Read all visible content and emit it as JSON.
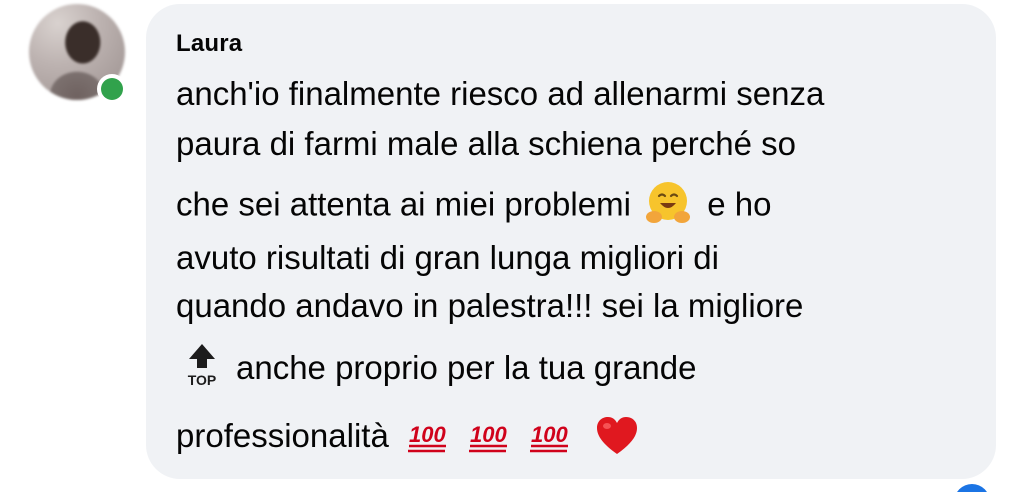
{
  "comment": {
    "author": "Laura",
    "online": true,
    "lines": {
      "l1": "anch'io finalmente riesco ad allenarmi senza",
      "l2": "paura di farmi male alla schiena perché so",
      "l3_before_emoji": "che sei attenta ai miei problemi",
      "l3_after_emoji": "e ho",
      "l4": "avuto risultati di gran lunga migliori di",
      "l5": "quando andavo in palestra!!! sei la migliore",
      "l6": "anche proprio per la tua grande",
      "l7": "professionalità"
    },
    "emojis": {
      "hug": "hugging-face-emoji",
      "top": "top-arrow-emoji",
      "top_label": "TOP",
      "hundred": "hundred-points-emoji",
      "hundred_count": 3,
      "hundred_text": "100",
      "heart": "red-heart-emoji"
    }
  },
  "colors": {
    "bubble": "#f0f2f5",
    "text": "#050505",
    "presence": "#31a24c",
    "hundred_red": "#d0021b",
    "heart_red": "#e0181f",
    "emoji_yellow": "#f7c42c"
  }
}
